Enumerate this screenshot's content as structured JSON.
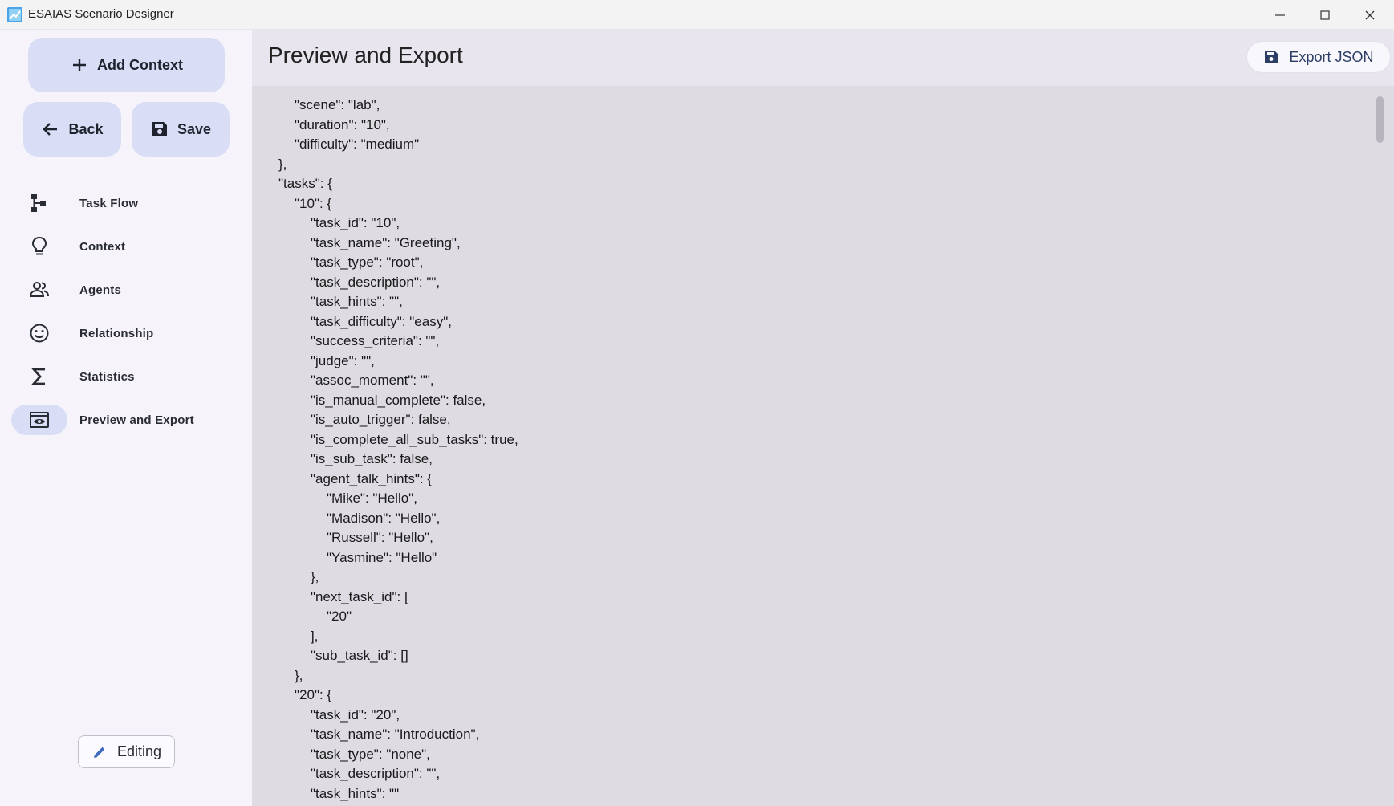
{
  "app": {
    "title": "ESAIAS Scenario Designer",
    "window_controls": {
      "minimize": "minimize-icon",
      "maximize": "maximize-icon",
      "close": "close-icon"
    }
  },
  "sidebar": {
    "add_context_label": "Add Context",
    "back_label": "Back",
    "save_label": "Save",
    "nav_items": [
      {
        "label": "Task Flow",
        "icon": "task-flow-icon"
      },
      {
        "label": "Context",
        "icon": "lightbulb-icon"
      },
      {
        "label": "Agents",
        "icon": "agents-icon"
      },
      {
        "label": "Relationship",
        "icon": "smiley-icon"
      },
      {
        "label": "Statistics",
        "icon": "sigma-icon"
      },
      {
        "label": "Preview and Export",
        "icon": "preview-icon",
        "active": true
      }
    ],
    "editing_label": "Editing"
  },
  "main": {
    "title": "Preview and Export",
    "export_label": "Export JSON",
    "json_lines": [
      {
        "indent": 1,
        "text": "\"scene\": \"lab\","
      },
      {
        "indent": 1,
        "text": "\"duration\": \"10\","
      },
      {
        "indent": 1,
        "text": "\"difficulty\": \"medium\""
      },
      {
        "indent": 0,
        "text": "},"
      },
      {
        "indent": 0,
        "text": "\"tasks\": {"
      },
      {
        "indent": 1,
        "text": "\"10\": {"
      },
      {
        "indent": 2,
        "text": "\"task_id\": \"10\","
      },
      {
        "indent": 2,
        "text": "\"task_name\": \"Greeting\","
      },
      {
        "indent": 2,
        "text": "\"task_type\": \"root\","
      },
      {
        "indent": 2,
        "text": "\"task_description\": \"\","
      },
      {
        "indent": 2,
        "text": "\"task_hints\": \"\","
      },
      {
        "indent": 2,
        "text": "\"task_difficulty\": \"easy\","
      },
      {
        "indent": 2,
        "text": "\"success_criteria\": \"\","
      },
      {
        "indent": 2,
        "text": "\"judge\": \"\","
      },
      {
        "indent": 2,
        "text": "\"assoc_moment\": \"\","
      },
      {
        "indent": 2,
        "text": "\"is_manual_complete\": false,"
      },
      {
        "indent": 2,
        "text": "\"is_auto_trigger\": false,"
      },
      {
        "indent": 2,
        "text": "\"is_complete_all_sub_tasks\": true,"
      },
      {
        "indent": 2,
        "text": "\"is_sub_task\": false,"
      },
      {
        "indent": 2,
        "text": "\"agent_talk_hints\": {"
      },
      {
        "indent": 3,
        "text": "\"Mike\": \"Hello\","
      },
      {
        "indent": 3,
        "text": "\"Madison\": \"Hello\","
      },
      {
        "indent": 3,
        "text": "\"Russell\": \"Hello\","
      },
      {
        "indent": 3,
        "text": "\"Yasmine\": \"Hello\""
      },
      {
        "indent": 2,
        "text": "},"
      },
      {
        "indent": 2,
        "text": "\"next_task_id\": ["
      },
      {
        "indent": 3,
        "text": "\"20\""
      },
      {
        "indent": 2,
        "text": "],"
      },
      {
        "indent": 2,
        "text": "\"sub_task_id\": []"
      },
      {
        "indent": 1,
        "text": "},"
      },
      {
        "indent": 1,
        "text": "\"20\": {"
      },
      {
        "indent": 2,
        "text": "\"task_id\": \"20\","
      },
      {
        "indent": 2,
        "text": "\"task_name\": \"Introduction\","
      },
      {
        "indent": 2,
        "text": "\"task_type\": \"none\","
      },
      {
        "indent": 2,
        "text": "\"task_description\": \"\","
      },
      {
        "indent": 2,
        "text": "\"task_hints\": \"\""
      }
    ]
  }
}
